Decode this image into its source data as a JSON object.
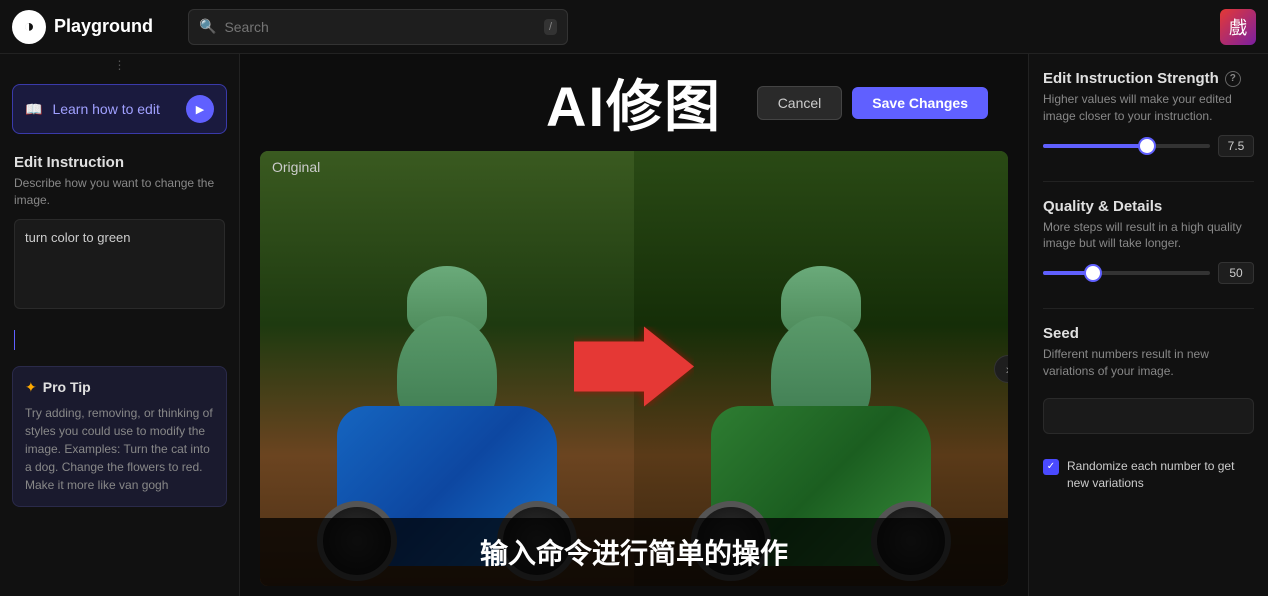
{
  "nav": {
    "logo_symbol": "◑",
    "logo_text": "Playground",
    "search_placeholder": "Search",
    "search_shortcut": "/",
    "user_emoji": "戲"
  },
  "left_sidebar": {
    "learn_btn_text": "Learn how to edit",
    "learn_btn_play": "▶",
    "edit_instruction": {
      "title": "Edit Instruction",
      "description": "Describe how you want to change the image.",
      "textarea_value": "turn color to green",
      "textarea_placeholder": "Describe how you want to change the image..."
    },
    "pro_tip": {
      "title": "Pro Tip",
      "icon": "✦",
      "text": "Try adding, removing, or thinking of styles you could use to modify the image. Examples: Turn the cat into a dog. Change the flowers to red. Make it more like van gogh"
    }
  },
  "center": {
    "title": "AI修图",
    "cancel_label": "Cancel",
    "save_label": "Save Changes",
    "original_label": "Original",
    "bottom_text": "输入命令进行简单的操作"
  },
  "right_sidebar": {
    "edit_strength": {
      "title": "Edit Instruction Strength",
      "info": "?",
      "description": "Higher values will make your edited image closer to your instruction.",
      "value": "7.5",
      "fill_percent": 62
    },
    "quality": {
      "title": "Quality & Details",
      "description": "More steps will result in a high quality image but will take longer.",
      "value": "50",
      "fill_percent": 30
    },
    "seed": {
      "title": "Seed",
      "description": "Different numbers result in new variations of your image.",
      "placeholder": ""
    },
    "randomize": {
      "label": "Randomize each number to get new variations",
      "checked": true
    }
  }
}
